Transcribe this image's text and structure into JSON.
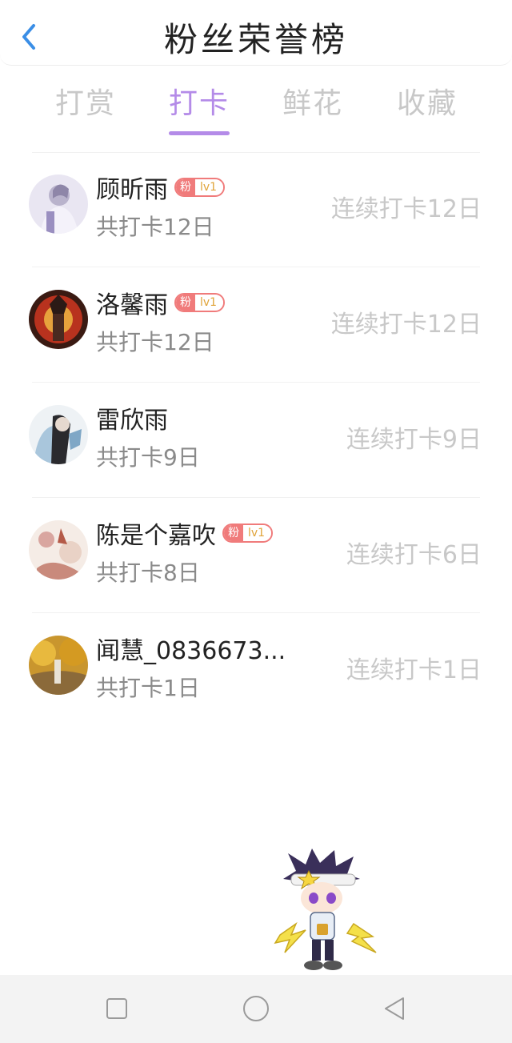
{
  "header": {
    "title": "粉丝荣誉榜",
    "back_icon": "chevron-left-icon",
    "accent": "#3a8ee6"
  },
  "tabs": [
    {
      "label": "打赏",
      "active": false
    },
    {
      "label": "打卡",
      "active": true
    },
    {
      "label": "鲜花",
      "active": false
    },
    {
      "label": "收藏",
      "active": false
    }
  ],
  "colors": {
    "active_tab": "#b48be8",
    "badge": "#f07b7b",
    "badge_level": "#e0a43a"
  },
  "badge_tag": "粉",
  "fans": [
    {
      "name": "顾昕雨",
      "badge_level": "lv1",
      "has_badge": true,
      "total": "共打卡12日",
      "streak": "连续打卡12日"
    },
    {
      "name": "洛馨雨",
      "badge_level": "lv1",
      "has_badge": true,
      "total": "共打卡12日",
      "streak": "连续打卡12日"
    },
    {
      "name": "雷欣雨",
      "badge_level": "",
      "has_badge": false,
      "total": "共打卡9日",
      "streak": "连续打卡9日"
    },
    {
      "name": "陈是个嘉吹",
      "badge_level": "lv1",
      "has_badge": true,
      "total": "共打卡8日",
      "streak": "连续打卡6日"
    },
    {
      "name": "闻慧_0836673...",
      "badge_level": "",
      "has_badge": false,
      "total": "共打卡1日",
      "streak": "连续打卡1日"
    }
  ],
  "navbar": {
    "icons": [
      "square-recents-icon",
      "circle-home-icon",
      "triangle-back-icon"
    ]
  }
}
